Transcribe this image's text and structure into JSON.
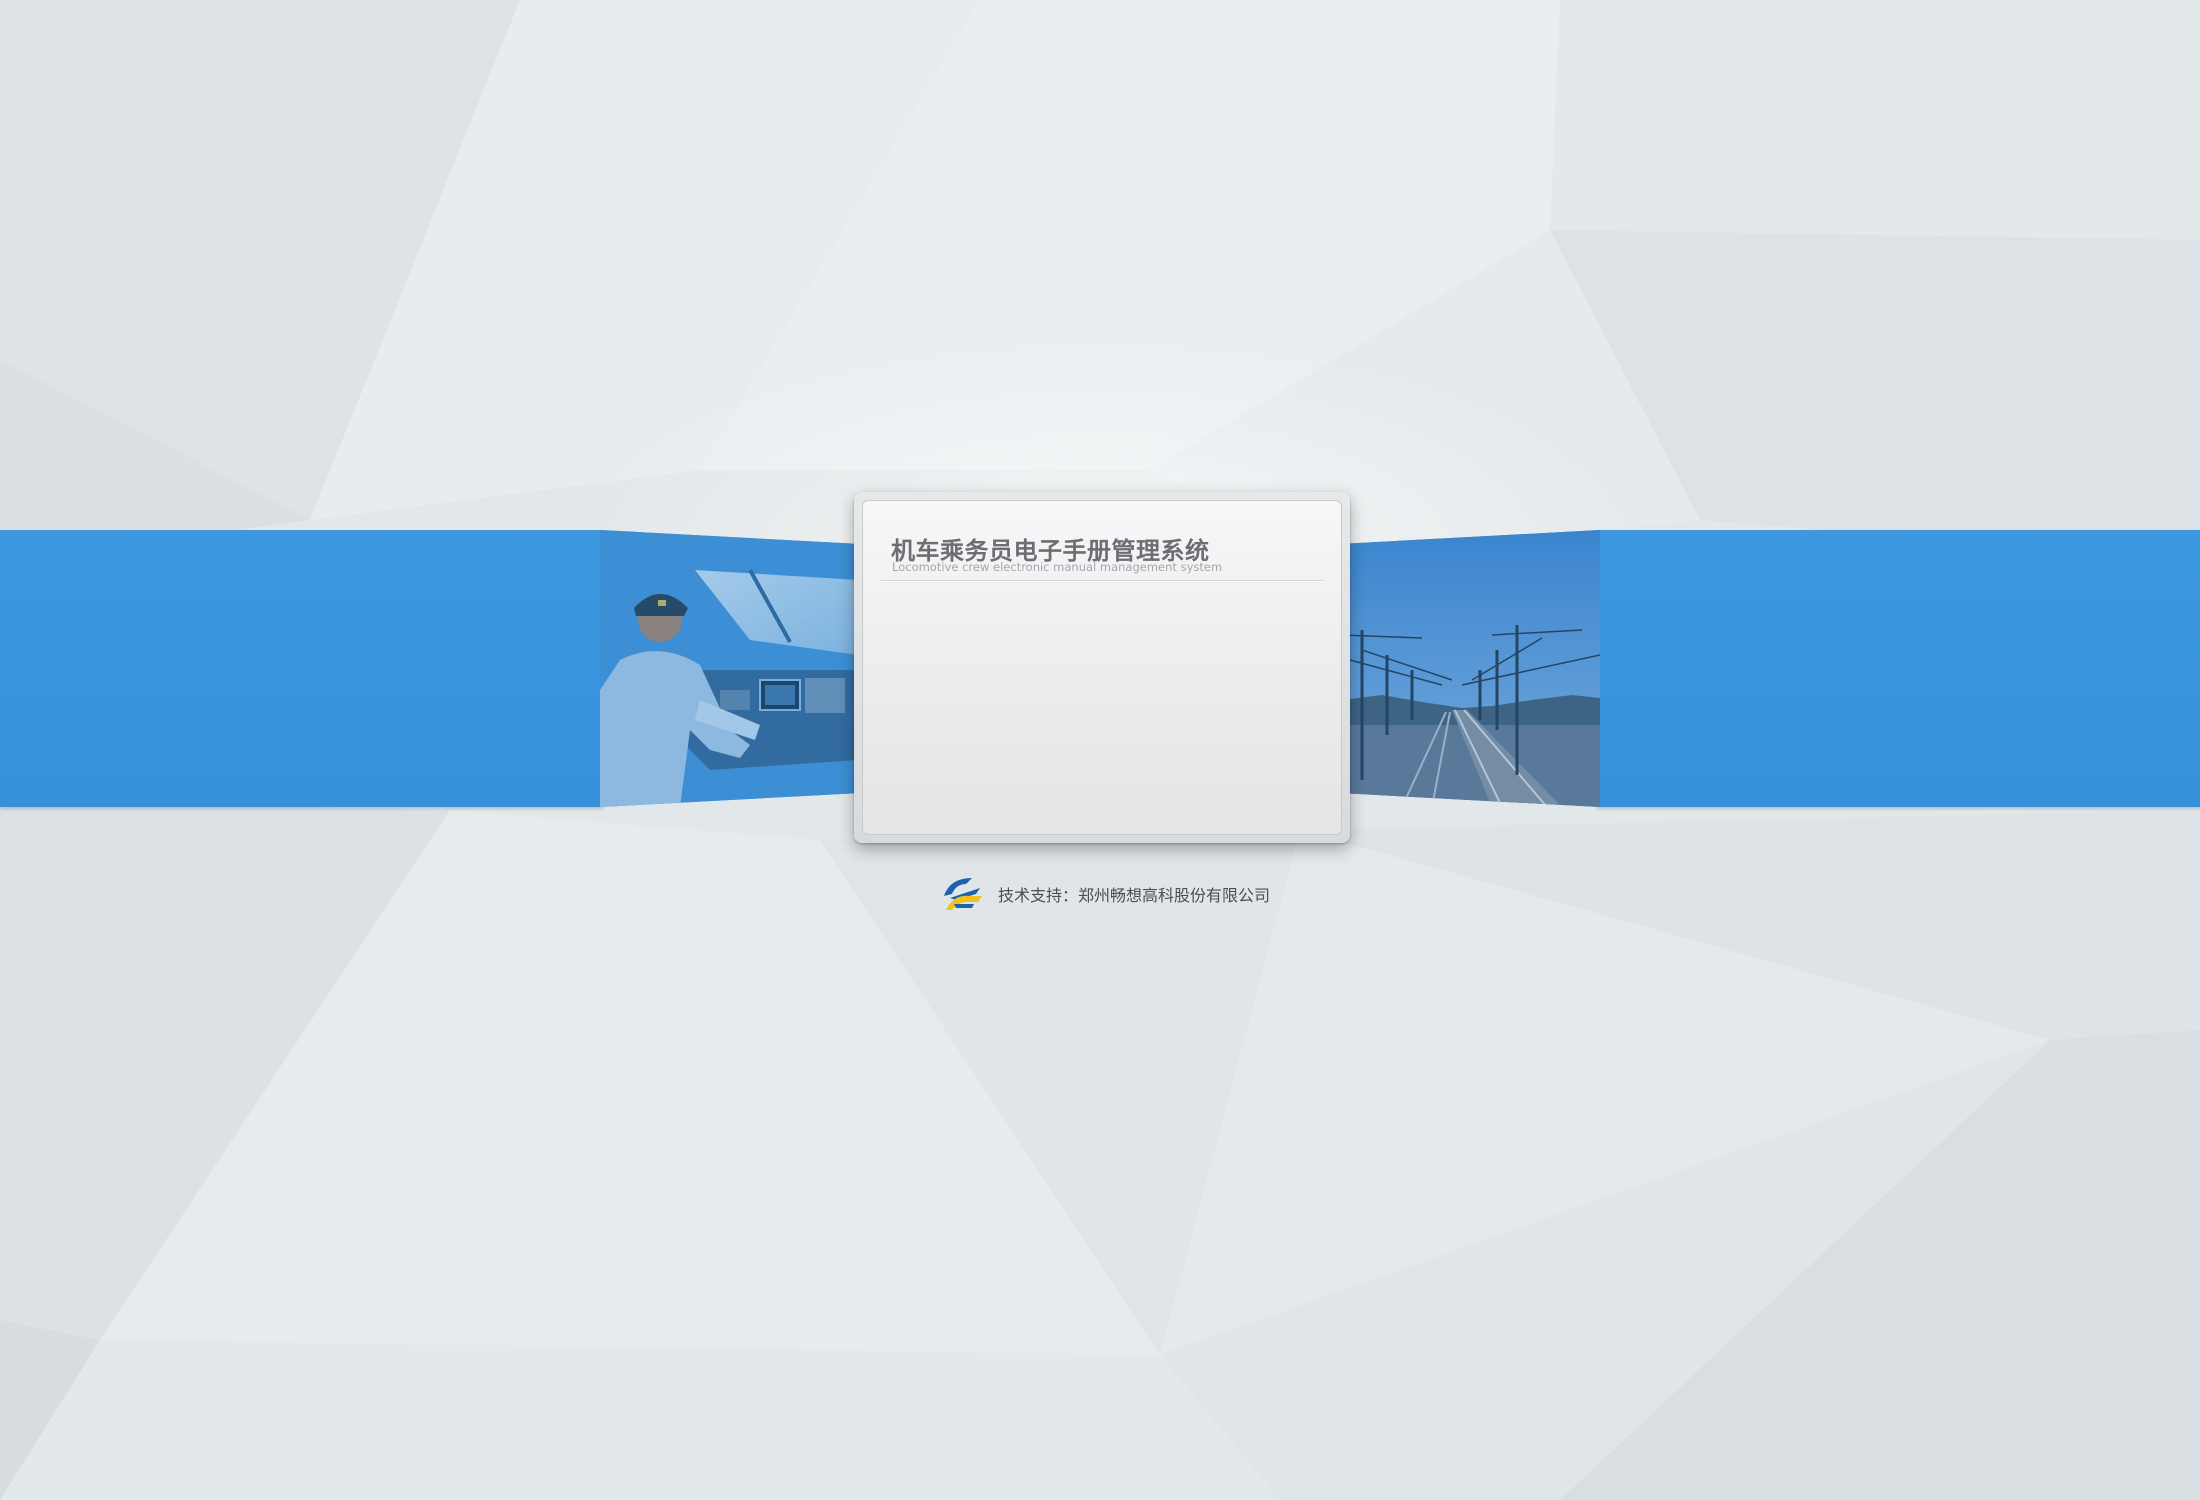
{
  "app": {
    "title": "机车乘务员电子手册管理系统",
    "subtitle": "Locomotive crew electronic manual management system"
  },
  "footer": {
    "support_text": "技术支持：郑州畅想高科股份有限公司"
  },
  "images": {
    "left_photo": "locomotive-cab-driver-photo",
    "right_photo": "railway-tracks-catenary-photo"
  },
  "icons": {
    "company_logo": "company-logo-icon"
  },
  "colors": {
    "band_blue": "#3a95de",
    "background": "#e3e8ea",
    "title_gray": "#6c6e71",
    "logo_blue": "#1d62b0",
    "logo_yellow": "#f2c21b"
  }
}
